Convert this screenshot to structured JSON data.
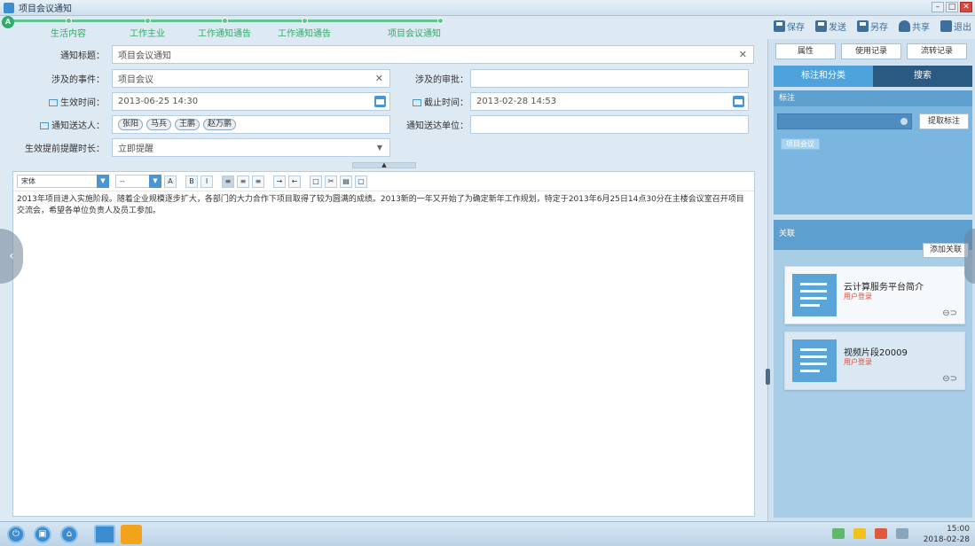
{
  "window": {
    "title": "项目会议通知"
  },
  "steps": [
    "生活内容",
    "工作主业",
    "工作通知通告",
    "工作通知通告",
    "项目会议通知"
  ],
  "toolbar": {
    "save": "保存",
    "send": "发送",
    "save_as": "另存",
    "share": "共享",
    "exit": "退出"
  },
  "form": {
    "notice_title_label": "通知标题：",
    "notice_title_value": "项目会议通知",
    "related_event_label": "涉及的事件：",
    "related_event_value": "项目会议",
    "related_approval_label": "涉及的审批：",
    "related_approval_value": "",
    "effective_time_label": "生效时间：",
    "effective_time_value": "2013-06-25 14:30",
    "deadline_label": "截止时间：",
    "deadline_value": "2013-02-28 14:53",
    "recipients_label": "通知送达人：",
    "recipients": [
      "张阳",
      "马兵",
      "王鹏",
      "赵万鹏"
    ],
    "recipient_org_label": "通知送达单位：",
    "recipient_org_value": "",
    "reminder_label": "生效提前提醒时长：",
    "reminder_value": "立即提醒"
  },
  "editor": {
    "font_name": "宋体",
    "font_size": "--",
    "content": "2013年项目进入实施阶段。随着企业规模逐步扩大，各部门的大力合作下项目取得了较为圆满的成绩。2013新的一年又开始了为确定新年工作规划，特定于2013年6月25日14点30分在主楼会议室召开项目交流会，希望各单位负责人及员工参加。"
  },
  "side": {
    "attr_btn": "属性",
    "usage_btn": "使用记录",
    "flow_btn": "流转记录",
    "tab_tags": "标注和分类",
    "tab_search": "搜索",
    "tags_head": "标注",
    "pick_tag": "提取标注",
    "tag_chip": "项目会议",
    "related_head": "关联",
    "add_related": "添加关联",
    "cards": [
      {
        "title": "云计算服务平台简介",
        "sub": "用户登录"
      },
      {
        "title": "视频片段20009",
        "sub": "用户登录"
      }
    ]
  },
  "taskbar": {
    "time": "15:00",
    "date": "2018-02-28"
  },
  "colors": {
    "accent": "#3c8dd0",
    "step_green": "#2fae68",
    "panel_dark": "#2a5a82"
  }
}
